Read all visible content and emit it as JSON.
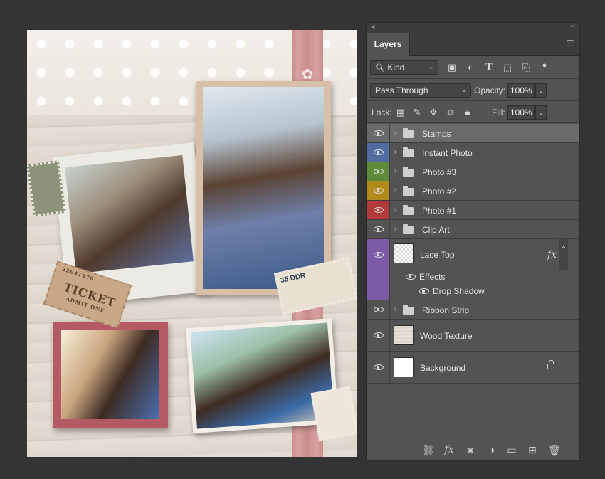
{
  "canvas": {
    "stamp_text": "35 DDR",
    "ticket_text": "TICKET",
    "ticket_sub": "ADMIT ONE",
    "ticket_number": "22041970"
  },
  "panel": {
    "tab_label": "Layers",
    "filter_kind": "Kind",
    "blend_mode": "Pass Through",
    "opacity_label": "Opacity:",
    "opacity_value": "100%",
    "lock_label": "Lock:",
    "fill_label": "Fill:",
    "fill_value": "100%",
    "layers": [
      {
        "name": "Stamps",
        "type": "group",
        "color": "",
        "selected": true
      },
      {
        "name": "Instant Photo",
        "type": "group",
        "color": "#4f6da0"
      },
      {
        "name": "Photo #3",
        "type": "group",
        "color": "#5f8a3c"
      },
      {
        "name": "Photo #2",
        "type": "group",
        "color": "#b08a1a"
      },
      {
        "name": "Photo #1",
        "type": "group",
        "color": "#b33a3a"
      },
      {
        "name": "Clip Art",
        "type": "group",
        "color": ""
      },
      {
        "name": "Lace Top",
        "type": "layer",
        "color": "#7d5aa6",
        "fx": "fx"
      },
      {
        "name": "Effects",
        "type": "effects"
      },
      {
        "name": "Drop Shadow",
        "type": "effect"
      },
      {
        "name": "Ribbon Strip",
        "type": "group",
        "color": ""
      },
      {
        "name": "Wood Texture",
        "type": "layer",
        "color": ""
      },
      {
        "name": "Background",
        "type": "layer",
        "color": "",
        "locked": true
      }
    ],
    "accent_selected": "#6a6a6a"
  }
}
